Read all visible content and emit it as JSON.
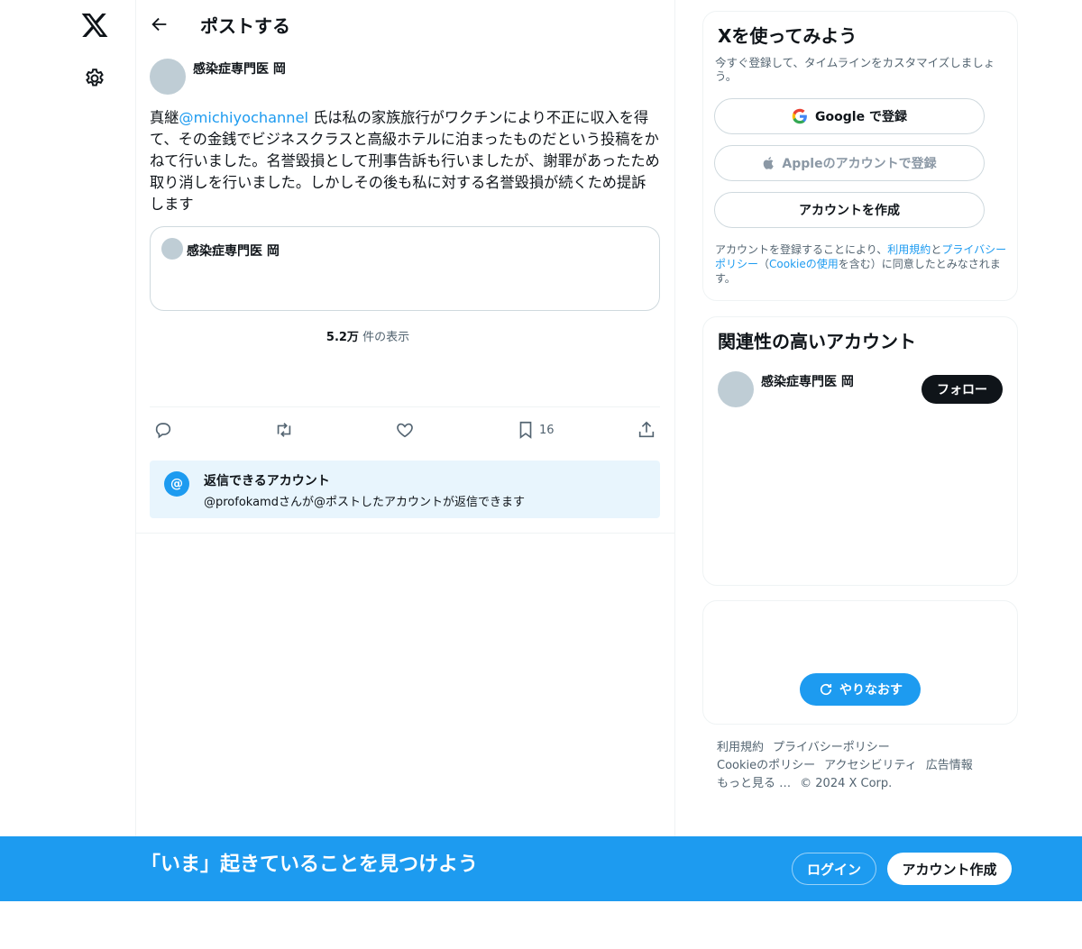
{
  "header": {
    "title": "ポストする"
  },
  "post": {
    "author_name": "感染症専門医 岡",
    "text_before": "真継",
    "mention": "@michiyochannel",
    "text_after": " 氏は私の家族旅行がワクチンにより不正に収入を得て、その金銭でビジネスクラスと高級ホテルに泊まったものだという投稿をかねて行いました。名誉毀損として刑事告訴も行いましたが、謝罪があったため取り消しを行いました。しかしその後も私に対する名誉毀損が続くため提訴します",
    "quote_author": "感染症専門医 岡",
    "views_count": "5.2万",
    "views_label": " 件の表示",
    "bookmark_count": "16"
  },
  "reply_restriction": {
    "icon": "@",
    "title": "返信できるアカウント",
    "subtitle": "@profokamdさんが@ポストしたアカウントが返信できます"
  },
  "signup_card": {
    "title": "Xを使ってみよう",
    "subtitle": "今すぐ登録して、タイムラインをカスタマイズしましょう。",
    "google": "Google で登録",
    "apple": "Appleのアカウントで登録",
    "create": "アカウントを作成",
    "legal_1": "アカウントを登録することにより、",
    "legal_terms": "利用規約",
    "legal_2": "と",
    "legal_privacy": "プライバシーポリシー",
    "legal_3": "（",
    "legal_cookie": "Cookieの使用",
    "legal_4": "を含む）に同意したとみなされます。"
  },
  "related": {
    "title": "関連性の高いアカウント",
    "name": "感染症専門医 岡",
    "follow": "フォロー"
  },
  "retry": {
    "label": "やりなおす"
  },
  "footer": {
    "terms": "利用規約",
    "privacy": "プライバシーポリシー",
    "cookie": "Cookieのポリシー",
    "accessibility": "アクセシビリティ",
    "ads": "広告情報",
    "more": "もっと見る …",
    "copyright": "© 2024 X Corp."
  },
  "banner": {
    "text": "「いま」起きていることを見つけよう",
    "login": "ログイン",
    "signup": "アカウント作成"
  },
  "colors": {
    "accent": "#1d9bf0",
    "text": "#0f1419",
    "muted": "#536471"
  }
}
